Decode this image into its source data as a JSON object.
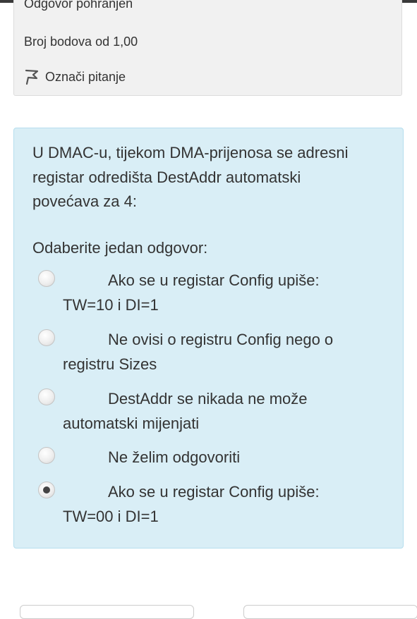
{
  "info": {
    "answer_saved": "Odgovor pohranjen",
    "points": "Broj bodova od 1,00",
    "flag_label": "Označi pitanje"
  },
  "question": {
    "text": "U DMAC-u, tijekom DMA-prijenosa se adresni registar odredišta DestAddr automatski povećava za 4:",
    "prompt": "Odaberite jedan odgovor:",
    "options": [
      {
        "label": "Ako se u registar Config upiše: TW=10 i DI=1",
        "selected": false
      },
      {
        "label": "Ne ovisi o registru Config nego o registru Sizes",
        "selected": false
      },
      {
        "label": "DestAddr se nikada ne može automatski mijenjati",
        "selected": false
      },
      {
        "label": "Ne želim odgovoriti",
        "selected": false
      },
      {
        "label": "Ako se u registar Config upiše: TW=00 i DI=1",
        "selected": true
      }
    ]
  },
  "colors": {
    "question_bg": "#d9eef6",
    "info_bg": "#f1f1f1",
    "text": "#333333"
  }
}
